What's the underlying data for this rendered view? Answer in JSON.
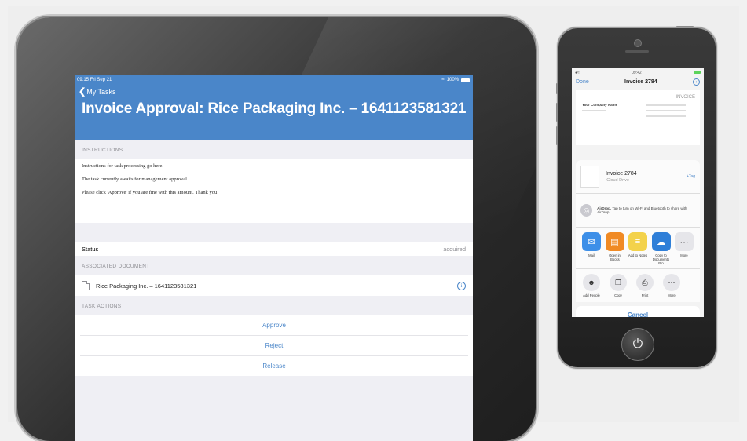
{
  "ipad": {
    "status_time": "09:15  Fri Sep 21",
    "status_battery": "100%",
    "back_label": "My Tasks",
    "title": "Invoice Approval: Rice Packaging Inc. – 1641123581321",
    "instructions_header": "INSTRUCTIONS",
    "instructions": [
      "Instructions for task processing go here.",
      "The task currently awaits for management approval.",
      "Please click 'Approve' if you are fine with this amount. Thank you!"
    ],
    "status_label": "Status",
    "status_value": "acquired",
    "doc_header": "ASSOCIATED DOCUMENT",
    "doc_name": "Rice Packaging Inc. – 1641123581321",
    "actions_header": "TASK ACTIONS",
    "actions": [
      "Approve",
      "Reject",
      "Release"
    ],
    "accent": "#4a86c9"
  },
  "iphone": {
    "status_time": "09:42",
    "done_label": "Done",
    "title": "Invoice 2784",
    "invoice_label": "INVOICE",
    "company": "Your Company Name",
    "file_name": "Invoice 2784",
    "file_location": "iCloud Drive",
    "tag_label": "+Tag",
    "airdrop_bold": "AirDrop.",
    "airdrop_text": "Tap to turn on Wi-Fi and Bluetooth to share with AirDrop.",
    "apps": [
      {
        "label": "Mail",
        "color": "#3d8fe8",
        "icon": "mail-icon"
      },
      {
        "label": "Open in iBooks",
        "color": "#f08a24",
        "icon": "ibooks-icon"
      },
      {
        "label": "Add to Notes",
        "color": "#f3d24b",
        "icon": "notes-icon"
      },
      {
        "label": "Copy to Documents Pro",
        "color": "#2f7fd8",
        "icon": "documents-icon"
      },
      {
        "label": "More",
        "color": "#e6e6ea",
        "icon": "more-icon"
      }
    ],
    "actions": [
      {
        "label": "Add People",
        "icon": "add-people-icon"
      },
      {
        "label": "Copy",
        "icon": "copy-icon"
      },
      {
        "label": "Print",
        "icon": "print-icon"
      },
      {
        "label": "More",
        "icon": "more-icon"
      }
    ],
    "cancel_label": "Cancel"
  }
}
